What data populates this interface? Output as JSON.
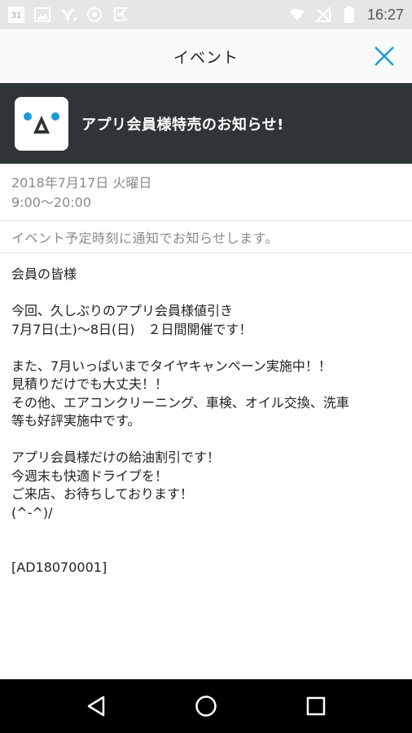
{
  "status_bar": {
    "calendar_day": "31",
    "time": "16:27",
    "icons": [
      "calendar-icon",
      "image-icon",
      "yahoo-icon",
      "shield-icon",
      "flag-icon",
      "wifi-icon",
      "signal-off-icon",
      "battery-icon"
    ]
  },
  "app_bar": {
    "title": "イベント",
    "close_icon": "close-icon",
    "accent": "#1e9bd7"
  },
  "banner": {
    "title": "アプリ会員様特売のお知らせ!",
    "background": "#2f3436"
  },
  "event": {
    "date": "2018年7月17日 火曜日",
    "time_range": "9:00〜20:00",
    "notice": "イベント予定時刻に通知でお知らせします。"
  },
  "message": {
    "lines": [
      "会員の皆様",
      "",
      "今回、久しぶりのアプリ会員様値引き",
      "7月7日(土)〜8日(日)　２日間開催です！",
      "",
      "また、7月いっぱいまでタイヤキャンペーン実施中！！",
      "見積りだけでも大丈夫！！",
      "その他、エアコンクリーニング、車検、オイル交換、洗車",
      "等も好評実施中です。",
      "",
      "アプリ会員様だけの給油割引です！",
      "今週末も快適ドライブを！",
      "ご来店、お待ちしております！",
      "(^-^)/",
      "",
      "",
      "[AD18070001]"
    ]
  },
  "nav": {
    "back": "back-icon",
    "home": "home-icon",
    "recents": "recents-icon"
  }
}
